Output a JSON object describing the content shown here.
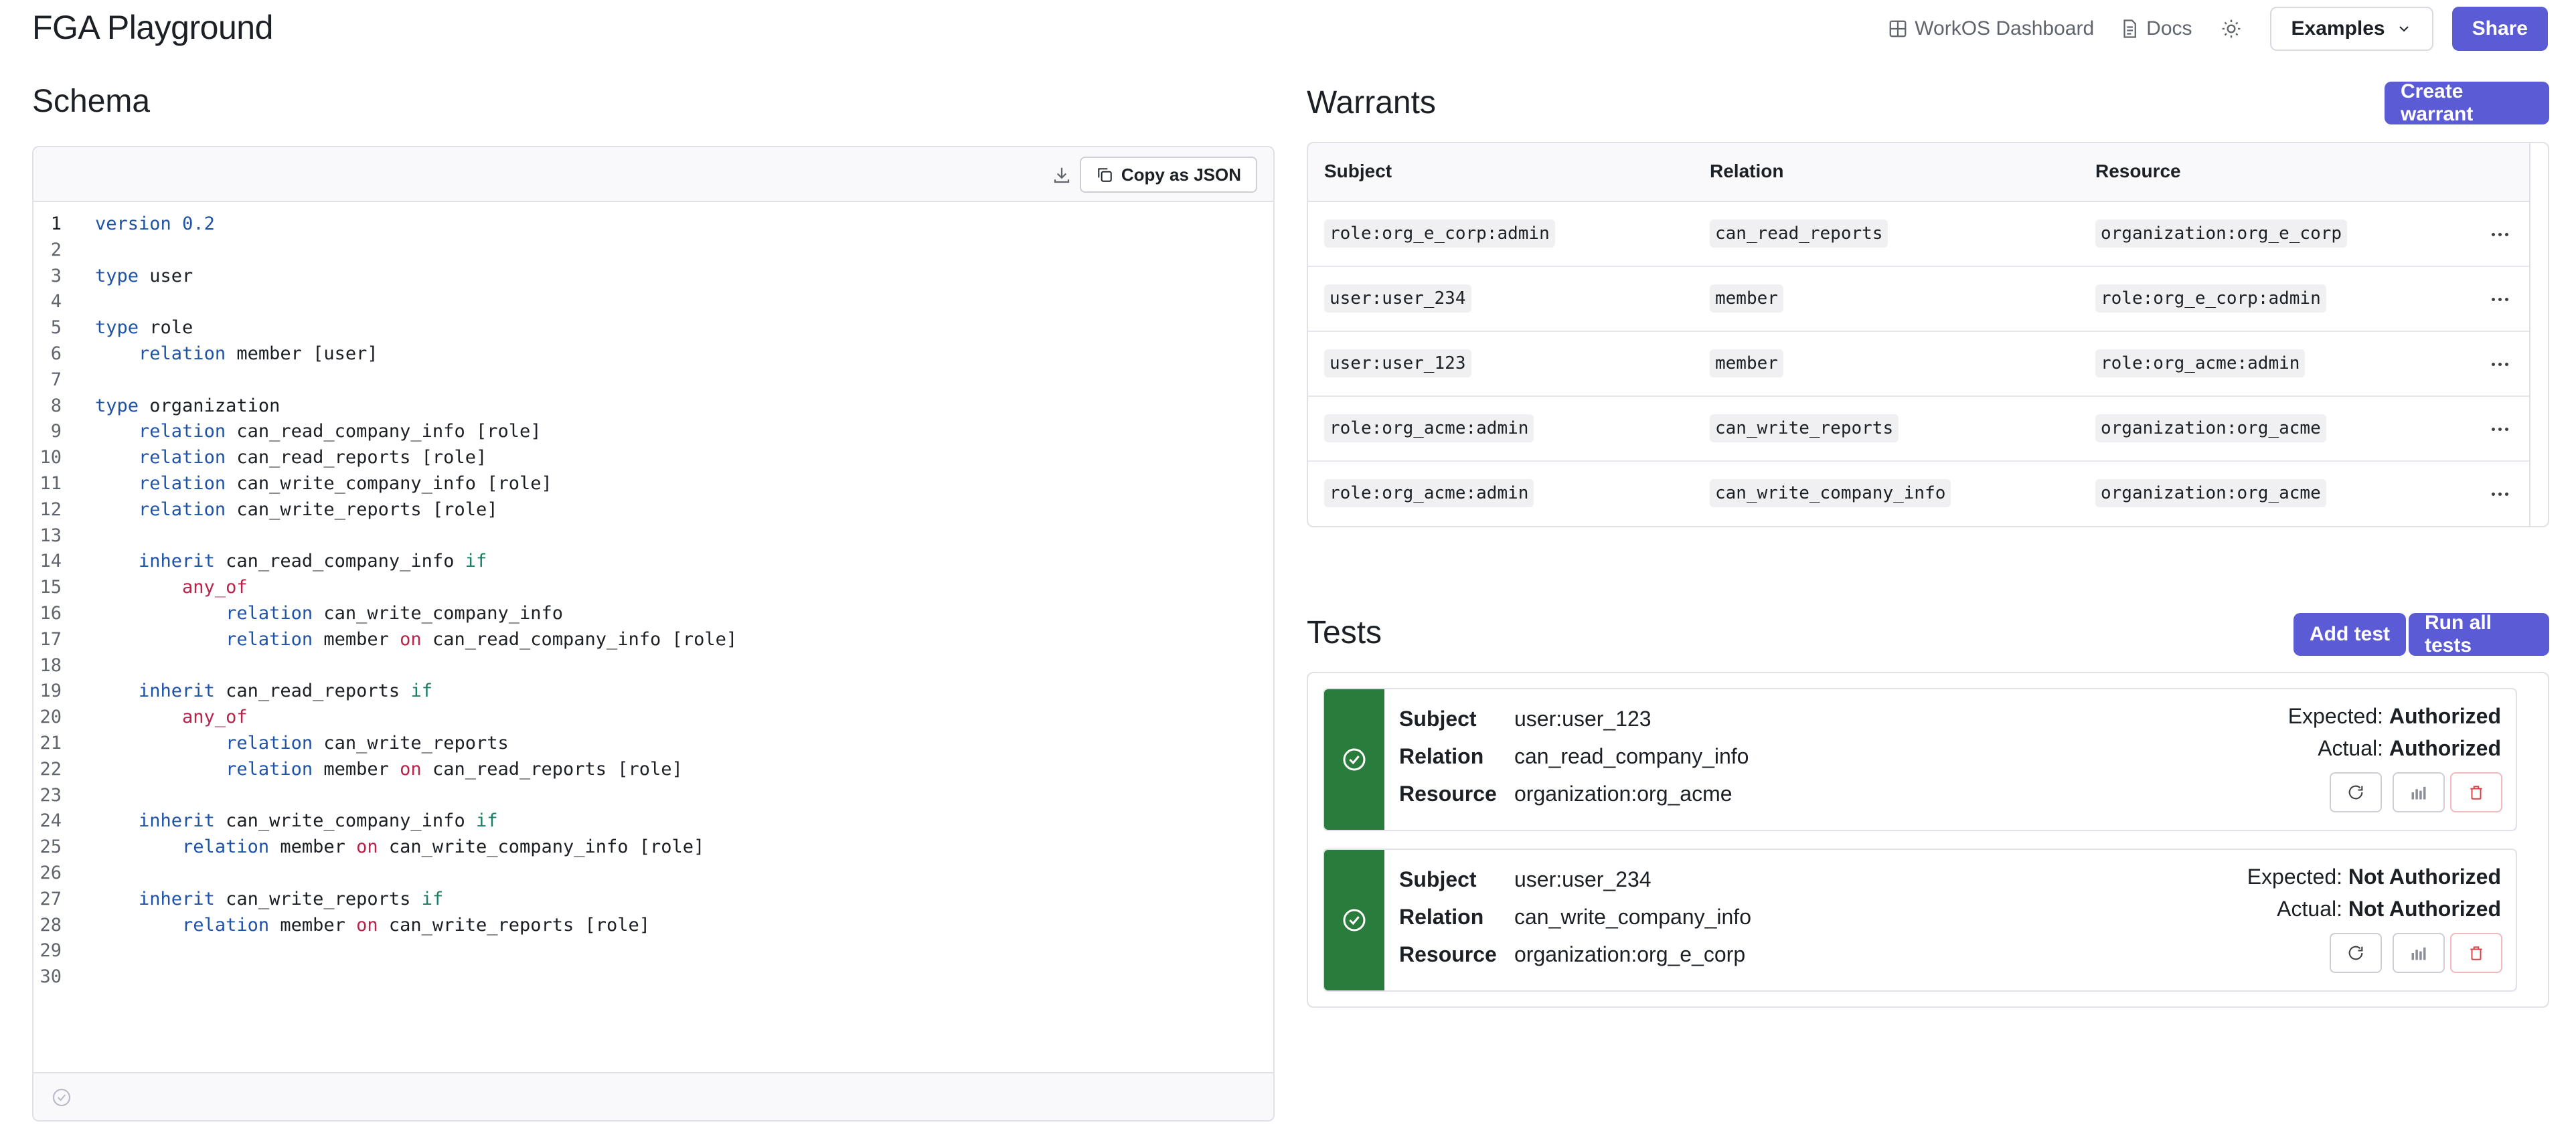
{
  "header": {
    "title": "FGA Playground",
    "dashboard_link": "WorkOS Dashboard",
    "docs_link": "Docs",
    "examples_label": "Examples",
    "share_label": "Share"
  },
  "schema": {
    "title": "Schema",
    "copy_label": "Copy as JSON",
    "lines": [
      "1",
      "2",
      "3",
      "4",
      "5",
      "6",
      "7",
      "8",
      "9",
      "10",
      "11",
      "12",
      "13",
      "14",
      "15",
      "16",
      "17",
      "18",
      "19",
      "20",
      "21",
      "22",
      "23",
      "24",
      "25",
      "26",
      "27",
      "28",
      "29",
      "30"
    ],
    "code": {
      "l1_kw": "version",
      "l1_num": "0.2",
      "l3_kw": "type",
      "l3_rest": " user",
      "l5_kw": "type",
      "l5_rest": " role",
      "l6_kw": "relation",
      "l6_rest": " member [user]",
      "l8_kw": "type",
      "l8_rest": " organization",
      "l9_kw": "relation",
      "l9_rest": " can_read_company_info [role]",
      "l10_kw": "relation",
      "l10_rest": " can_read_reports [role]",
      "l11_kw": "relation",
      "l11_rest": " can_write_company_info [role]",
      "l12_kw": "relation",
      "l12_rest": " can_write_reports [role]",
      "l14_kw": "inherit",
      "l14_rest": " can_read_company_info ",
      "l14_if": "if",
      "l15_any": "any_of",
      "l16_kw": "relation",
      "l16_rest": " can_write_company_info",
      "l17_kw": "relation",
      "l17_mid": " member ",
      "l17_on": "on",
      "l17_rest": " can_read_company_info [role]",
      "l19_kw": "inherit",
      "l19_rest": " can_read_reports ",
      "l19_if": "if",
      "l20_any": "any_of",
      "l21_kw": "relation",
      "l21_rest": " can_write_reports",
      "l22_kw": "relation",
      "l22_mid": " member ",
      "l22_on": "on",
      "l22_rest": " can_read_reports [role]",
      "l24_kw": "inherit",
      "l24_rest": " can_write_company_info ",
      "l24_if": "if",
      "l25_kw": "relation",
      "l25_mid": " member ",
      "l25_on": "on",
      "l25_rest": " can_write_company_info [role]",
      "l27_kw": "inherit",
      "l27_rest": " can_write_reports ",
      "l27_if": "if",
      "l28_kw": "relation",
      "l28_mid": " member ",
      "l28_on": "on",
      "l28_rest": " can_write_reports [role]"
    }
  },
  "warrants": {
    "title": "Warrants",
    "create_label": "Create warrant",
    "columns": [
      "Subject",
      "Relation",
      "Resource"
    ],
    "rows": [
      {
        "subject": "role:org_e_corp:admin",
        "relation": "can_read_reports",
        "resource": "organization:org_e_corp"
      },
      {
        "subject": "user:user_234",
        "relation": "member",
        "resource": "role:org_e_corp:admin"
      },
      {
        "subject": "user:user_123",
        "relation": "member",
        "resource": "role:org_acme:admin"
      },
      {
        "subject": "role:org_acme:admin",
        "relation": "can_write_reports",
        "resource": "organization:org_acme"
      },
      {
        "subject": "role:org_acme:admin",
        "relation": "can_write_company_info",
        "resource": "organization:org_acme"
      }
    ]
  },
  "tests": {
    "title": "Tests",
    "add_label": "Add test",
    "run_label": "Run all tests",
    "field_labels": {
      "subject": "Subject",
      "relation": "Relation",
      "resource": "Resource"
    },
    "expected_label": "Expected:",
    "actual_label": "Actual:",
    "items": [
      {
        "subject": "user:user_123",
        "relation": "can_read_company_info",
        "resource": "organization:org_acme",
        "expected": "Authorized",
        "actual": "Authorized"
      },
      {
        "subject": "user:user_234",
        "relation": "can_write_company_info",
        "resource": "organization:org_e_corp",
        "expected": "Not Authorized",
        "actual": "Not Authorized"
      }
    ]
  },
  "colors": {
    "accent": "#5b5bd6",
    "pass": "#297c3b",
    "danger": "#dc3e42"
  }
}
